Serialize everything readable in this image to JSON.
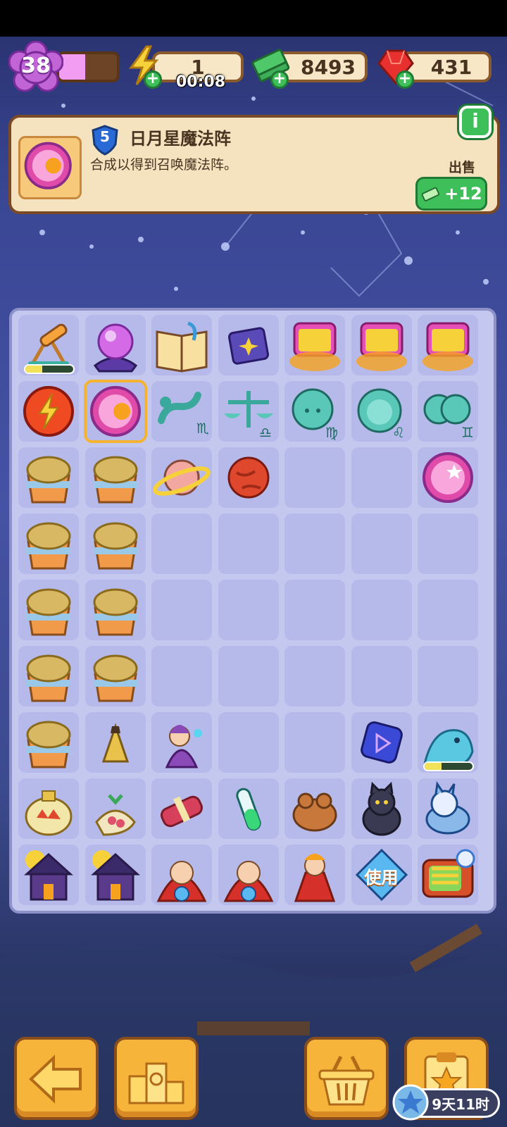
{
  "header": {
    "level": "38",
    "level_progress": 0.45,
    "energy": "1",
    "energy_timer": "00:08",
    "cash": "8493",
    "gems": "431"
  },
  "selected_item": {
    "level": "5",
    "name": "日月星魔法阵",
    "description": "合成以得到召唤魔法阵。",
    "sell_label": "出售",
    "sell_price": "+12",
    "info_label": "i"
  },
  "board": {
    "rows": [
      [
        "telescope",
        "crystal-ball",
        "spell-book",
        "purple-book",
        "magic-scroll",
        "magic-scroll",
        "magic-scroll"
      ],
      [
        "energy-orb",
        "sun-moon-circle",
        "scorpio-statue",
        "libra-statue",
        "virgo-statue",
        "leo-statue",
        "gemini-statue"
      ],
      [
        "gold-pot",
        "gold-pot",
        "saturn",
        "mars",
        "",
        "",
        "moon-star-circle"
      ],
      [
        "gold-pot",
        "gold-pot",
        "",
        "",
        "",
        "",
        ""
      ],
      [
        "gold-pot",
        "gold-pot",
        "",
        "",
        "",
        "",
        ""
      ],
      [
        "gold-pot",
        "gold-pot",
        "",
        "",
        "",
        "",
        ""
      ],
      [
        "gold-pot",
        "incense-cone",
        "wizard-kid",
        "",
        "",
        "rune-stone",
        "ice-dragon"
      ],
      [
        "potion-jar",
        "herb-pouch",
        "meat-bundle",
        "test-tube",
        "toad",
        "black-cat",
        "ice-wolf"
      ],
      [
        "haunted-house",
        "haunted-house",
        "red-sorceress",
        "red-sorceress",
        "fire-mage",
        "use-gem",
        "tv-set"
      ]
    ],
    "use_label": "使用",
    "telescope_progress": 0.35,
    "dragon_progress": 0.35
  },
  "footer": {
    "event_timer": "9天11时"
  },
  "colors": {
    "accent": "#f6b53a",
    "cash_green": "#3fbf5a",
    "panel": "#f5e3bf",
    "board": "#c4c8ef"
  }
}
